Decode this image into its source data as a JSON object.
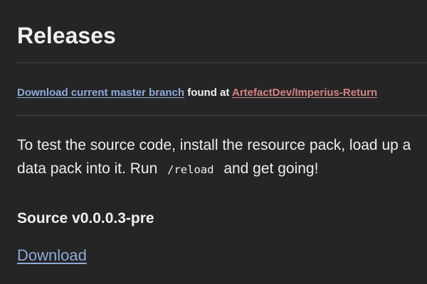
{
  "header": {
    "title": "Releases"
  },
  "source_line": {
    "link_text": "Download current master branch",
    "connector": " found at ",
    "repo_link": "ArtefactDev/Imperius-Return"
  },
  "description": {
    "line1": "To test the source code, install the resource pack, load up a",
    "line2_prefix": "data pack into it. Run",
    "code": "/reload",
    "line2_suffix": "and get going!"
  },
  "release": {
    "version_title": "Source v0.0.0.3-pre",
    "download_label": "Download"
  },
  "colors": {
    "background": "#252525",
    "text": "#ededed",
    "link_blue": "#8fa8d9",
    "link_red": "#d38383",
    "divider": "#4a4a4a"
  }
}
